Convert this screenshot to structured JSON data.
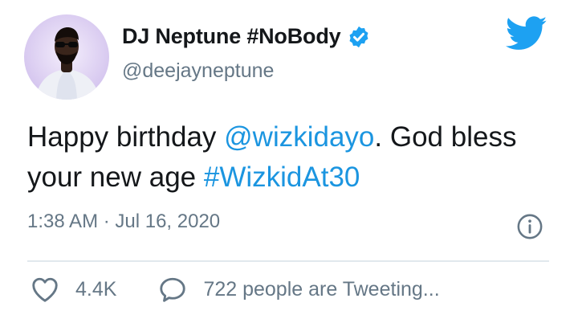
{
  "author": {
    "display_name": "DJ Neptune #NoBody",
    "handle": "@deejayneptune",
    "verified": true
  },
  "tweet": {
    "text_part1": "Happy birthday ",
    "mention": "@wizkidayo",
    "text_part2": ". God bless your new age ",
    "hashtag": "#WizkidAt30",
    "timestamp": "1:38 AM · Jul 16, 2020"
  },
  "actions": {
    "likes": "4.4K",
    "tweeting": "722 people are Tweeting..."
  },
  "colors": {
    "link": "#1b95e0",
    "secondary_text": "#657786",
    "twitter_blue": "#1da1f2"
  },
  "icons": [
    "twitter-bird-icon",
    "verified-badge-icon",
    "info-icon",
    "heart-icon",
    "speech-bubble-icon"
  ]
}
